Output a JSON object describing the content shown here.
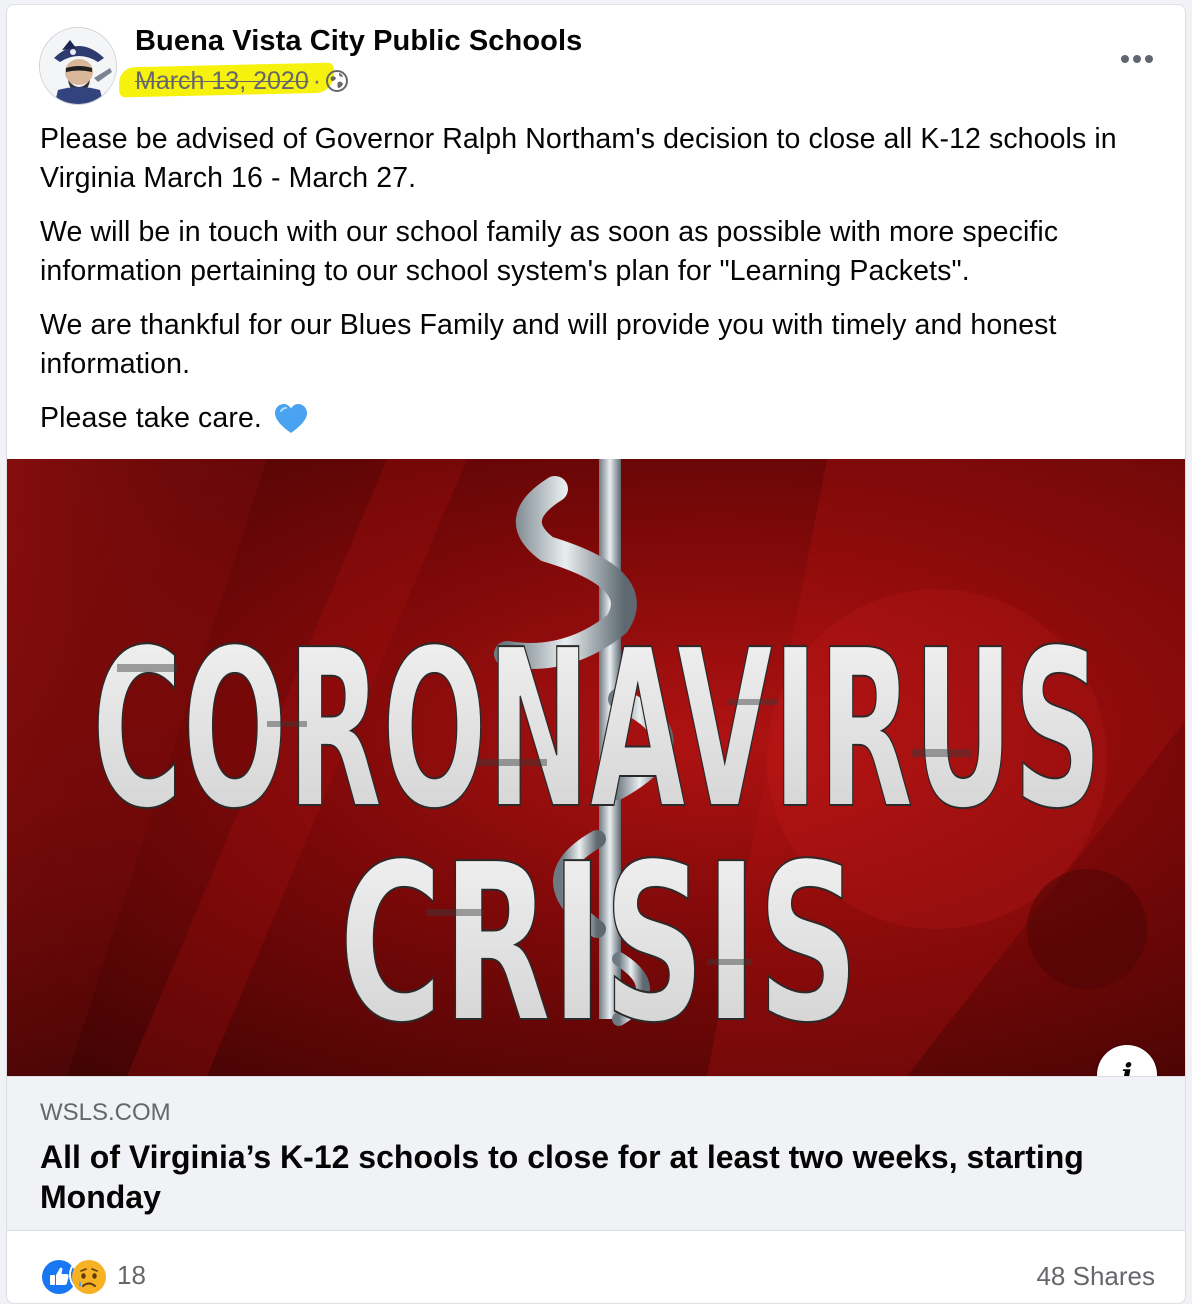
{
  "post": {
    "page_name": "Buena Vista City Public Schools",
    "date": "March 13, 2020",
    "separator": "·",
    "audience_icon": "globe-icon",
    "paragraphs": [
      "Please be advised of Governor Ralph Northam's decision to close all K-12 schools in Virginia March 16 - March 27.",
      "We will be in touch with our school family as soon as possible with more specific information pertaining to our school system's plan for \"Learning Packets\".",
      "We are thankful for our Blues Family and will provide you with timely and honest information."
    ],
    "closing_text": "Please take care.",
    "closing_emoji": "blue-heart-icon"
  },
  "link_preview": {
    "image_line1": "CORONAVIRUS",
    "image_line2": "CRISIS",
    "domain": "WSLS.COM",
    "title": "All of Virginia’s K-12 schools to close for at least two weeks, starting Monday",
    "info_label": "i"
  },
  "footer": {
    "reaction_icons": [
      "like-icon",
      "sad-icon"
    ],
    "reaction_count": "18",
    "shares": "48 Shares"
  },
  "colors": {
    "highlight": "#f6f000",
    "secondary_text": "#65676b",
    "like_blue": "#1877f2",
    "heart_blue": "#4aa3f0",
    "hero_red": "#8a0a0a"
  }
}
